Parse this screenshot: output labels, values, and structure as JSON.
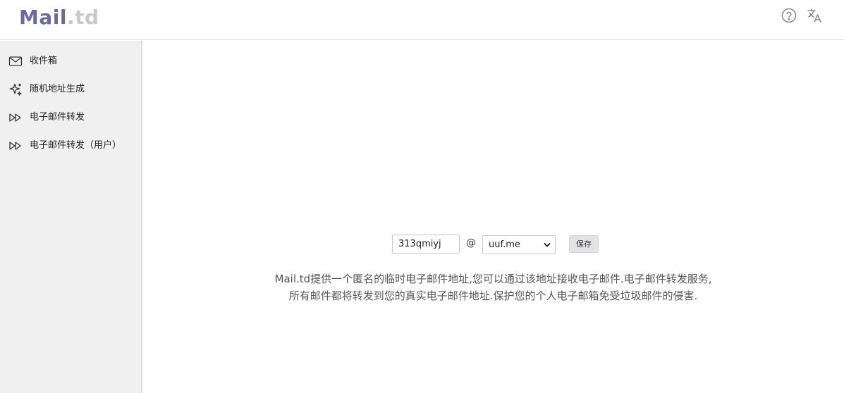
{
  "header": {
    "logo_main": "Mail",
    "logo_sub": ".td",
    "icons": [
      "help-circle-icon",
      "translate-icon"
    ],
    "logo_colors": {
      "main": "#6a6aa0",
      "sub": "#c8c8c8"
    }
  },
  "sidebar": {
    "background": "#f0f0f0",
    "items": [
      {
        "label": "收件箱",
        "icon": "mail-icon"
      },
      {
        "label": "随机地址生成",
        "icon": "sparkle-icon"
      },
      {
        "label": "电子邮件转发",
        "icon": "forward-icon"
      },
      {
        "label": "电子邮件转发（用户）",
        "icon": "forward-icon"
      }
    ]
  },
  "form": {
    "username_value": "313qmiyj",
    "at": "@",
    "domain_selected": "uuf.me",
    "save_label": "保存"
  },
  "description": {
    "line1": "Mail.td提供一个匿名的临时电子邮件地址,您可以通过该地址接收电子邮件.电子邮件转发服务,",
    "line2": "所有邮件都将转发到您的真实电子邮件地址.保护您的个人电子邮箱免受垃圾邮件的侵害."
  }
}
